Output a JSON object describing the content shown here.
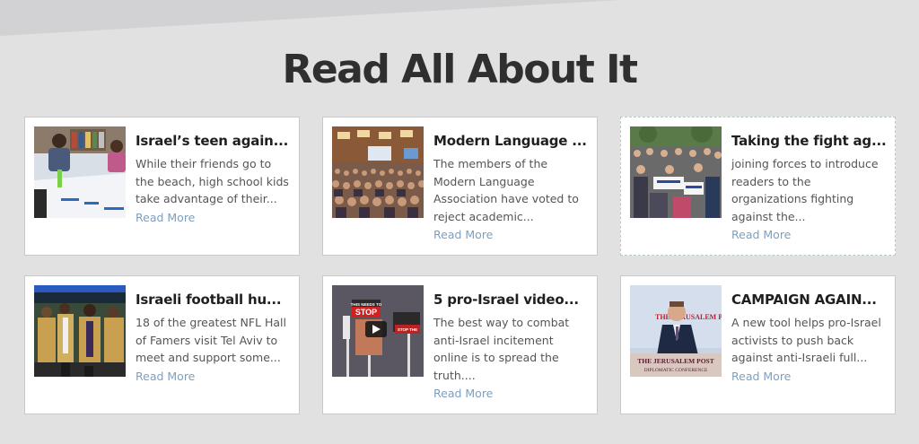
{
  "section": {
    "title": "Read All About It"
  },
  "cards": [
    {
      "title": "Israel’s teen again...",
      "excerpt": "While their friends go to the beach, high school kids take advantage of their...",
      "link": "Read More",
      "image_icon": "classroom-photo-icon"
    },
    {
      "title": "Modern Language ...",
      "excerpt": "The members of the Modern Language Association have voted to reject academic...",
      "link": "Read More",
      "image_icon": "conference-audience-photo-icon"
    },
    {
      "title": "Taking the fight ag...",
      "excerpt": "joining forces to introduce readers to the organizations fighting against the...",
      "link": "Read More",
      "image_icon": "rally-crowd-photo-icon"
    },
    {
      "title": "Israeli football hu...",
      "excerpt": "18 of the greatest NFL Hall of Famers visit Tel Aviv to meet and support some...",
      "link": "Read More",
      "image_icon": "football-players-photo-icon"
    },
    {
      "title": "5 pro-Israel video...",
      "excerpt": "The best way to combat anti-Israel incitement online is to spread the truth....",
      "link": "Read More",
      "image_icon": "video-thumbnail-icon",
      "image_text": {
        "sign1": "THIS NEEDS TO",
        "sign2": "STOP",
        "sign3": "STOP THE"
      }
    },
    {
      "title": "CAMPAIGN AGAIN...",
      "excerpt": "A new tool helps pro-Israel activists to push back against anti-Israeli full...",
      "link": "Read More",
      "image_icon": "speaker-podium-photo-icon",
      "image_text": {
        "banner": "THE JERUSALEM POST",
        "podium1": "THE JERUSALEM POST",
        "podium2": "DIPLOMATIC CONFERENCE"
      }
    }
  ],
  "colors": {
    "background": "#e1e1e2",
    "title": "#2f2f30",
    "link": "#7f9fbd"
  }
}
